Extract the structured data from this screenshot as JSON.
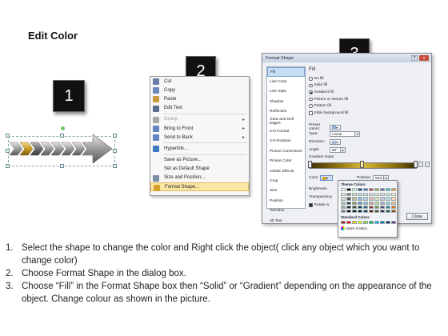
{
  "title": "Edit Color",
  "steps_badges": [
    "1",
    "2",
    "3"
  ],
  "context_menu": {
    "items": [
      {
        "label": "Cut",
        "icon": "scissors-icon",
        "icon_color": "#6a7fa8",
        "disabled": false,
        "submenu": false
      },
      {
        "label": "Copy",
        "icon": "copy-icon",
        "icon_color": "#6b8bbf",
        "disabled": false,
        "submenu": false
      },
      {
        "label": "Paste",
        "icon": "clipboard-icon",
        "icon_color": "#c89a3c",
        "disabled": false,
        "submenu": false
      },
      {
        "label": "Edit Text",
        "icon": "text-icon",
        "icon_color": "#5a6e90",
        "disabled": false,
        "submenu": false
      },
      {
        "label": "Group",
        "icon": "group-icon",
        "icon_color": "#a8a8a8",
        "disabled": true,
        "submenu": true
      },
      {
        "label": "Bring to Front",
        "icon": "bring-front-icon",
        "icon_color": "#6284c0",
        "disabled": false,
        "submenu": true
      },
      {
        "label": "Send to Back",
        "icon": "send-back-icon",
        "icon_color": "#6284c0",
        "disabled": false,
        "submenu": true
      },
      {
        "label": "Hyperlink...",
        "icon": "hyperlink-icon",
        "icon_color": "#3d7ac0",
        "disabled": false,
        "submenu": false
      },
      {
        "label": "Save as Picture...",
        "icon": "",
        "icon_color": "",
        "disabled": false,
        "submenu": false
      },
      {
        "label": "Set as Default Shape",
        "icon": "",
        "icon_color": "",
        "disabled": false,
        "submenu": false
      },
      {
        "label": "Size and Position...",
        "icon": "size-icon",
        "icon_color": "#7c8ea8",
        "disabled": false,
        "submenu": false
      },
      {
        "label": "Format Shape...",
        "icon": "format-shape-icon",
        "icon_color": "#d4a12c",
        "disabled": false,
        "submenu": false,
        "highlighted": true
      }
    ]
  },
  "dialog": {
    "title": "Format Shape",
    "help": "?",
    "close_x": "x",
    "nav": [
      "Fill",
      "Line Color",
      "Line Style",
      "Shadow",
      "Reflection",
      "Glow and Soft Edges",
      "3-D Format",
      "3-D Rotation",
      "Picture Corrections",
      "Picture Color",
      "Artistic Effects",
      "Crop",
      "Size",
      "Position",
      "Text Box",
      "Alt Text"
    ],
    "nav_selected": 0,
    "pane_heading": "Fill",
    "fill_options": [
      {
        "label": "No fill",
        "type": "radio",
        "checked": false
      },
      {
        "label": "Solid fill",
        "type": "radio",
        "checked": false
      },
      {
        "label": "Gradient fill",
        "type": "radio",
        "checked": true
      },
      {
        "label": "Picture or texture fill",
        "type": "radio",
        "checked": false
      },
      {
        "label": "Pattern fill",
        "type": "radio",
        "checked": false
      },
      {
        "label": "Slide background fill",
        "type": "checkbox",
        "checked": false
      }
    ],
    "preset_colors_label": "Preset colors:",
    "type_label": "Type:",
    "type_value": "Linear",
    "direction_label": "Direction:",
    "angle_label": "Angle:",
    "angle_value": "90°",
    "gradient_stops_label": "Gradient stops",
    "color_label": "Color",
    "position_label": "Position:",
    "position_value": "50%",
    "brightness_label": "Brightness",
    "transparency_label": "Transparency",
    "rotate_label": "Rotate w",
    "close_button": "Close",
    "palette": {
      "theme_label": "Theme Colors",
      "standard_label": "Standard Colors",
      "more_label": "More Colors...",
      "theme_top": [
        "#ffffff",
        "#000000",
        "#eeece1",
        "#1f497d",
        "#4f81bd",
        "#c0504d",
        "#9bbb59",
        "#8064a2",
        "#4bacc6",
        "#f79646"
      ],
      "theme_shades": [
        [
          "#f2f2f2",
          "#7f7f7f",
          "#ddd9c3",
          "#c6d9f0",
          "#dbe5f1",
          "#f2dcdb",
          "#ebf1dd",
          "#e5e0ec",
          "#dbeef3",
          "#fdeada"
        ],
        [
          "#d8d8d8",
          "#595959",
          "#c4bd97",
          "#8db3e2",
          "#b8cce4",
          "#e5b9b7",
          "#d7e3bc",
          "#ccc1d9",
          "#b7dde8",
          "#fbd5b5"
        ],
        [
          "#bfbfbf",
          "#3f3f3f",
          "#938953",
          "#548dd4",
          "#95b3d7",
          "#d99694",
          "#c3d69b",
          "#b2a2c7",
          "#92cddc",
          "#fac08f"
        ],
        [
          "#a5a5a5",
          "#262626",
          "#494429",
          "#17365d",
          "#366092",
          "#953734",
          "#76923c",
          "#5f497a",
          "#31859b",
          "#e36c09"
        ],
        [
          "#7f7f7f",
          "#0c0c0c",
          "#1d1b10",
          "#0f243e",
          "#244061",
          "#632423",
          "#4f6128",
          "#3f3151",
          "#205867",
          "#974806"
        ]
      ],
      "standard": [
        "#c00000",
        "#ff0000",
        "#ffc000",
        "#ffff00",
        "#92d050",
        "#00b050",
        "#00b0f0",
        "#0070c0",
        "#002060",
        "#7030a0"
      ]
    }
  },
  "instructions": [
    {
      "num": "1.",
      "text": "Select the shape to change the color and Right click the object( click any object which you want to change color)"
    },
    {
      "num": "2.",
      "text": "Choose Format Shape in the dialog box."
    },
    {
      "num": "3.",
      "text": "Choose “Fill” in the Format Shape box then “Solid” or “Gradient” depending on the appearance of the object. Change colour as shown in the picture."
    }
  ],
  "colors": {
    "badge_bg": "#111111",
    "menu_highlight": "#fce6a6",
    "arrow_gold": "#d4a83a",
    "arrow_grey": "#8a8a8a"
  }
}
